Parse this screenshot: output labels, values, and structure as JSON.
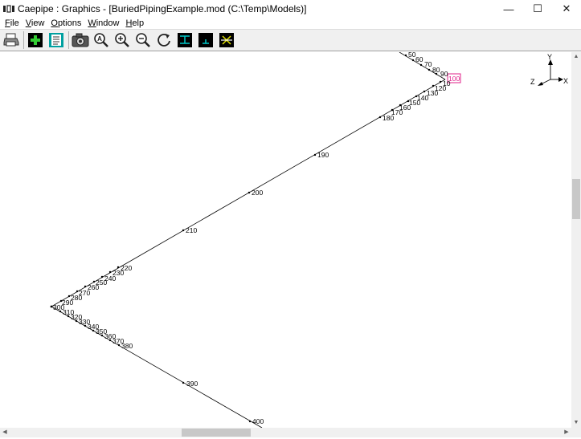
{
  "window": {
    "title": "Caepipe : Graphics -  [BuriedPipingExample.mod (C:\\Temp\\Models)]",
    "minimize": "—",
    "maximize": "☐",
    "close": "✕"
  },
  "menu": [
    {
      "label": "File",
      "underline": "F",
      "rest": "ile"
    },
    {
      "label": "View",
      "underline": "V",
      "rest": "iew"
    },
    {
      "label": "Options",
      "underline": "O",
      "rest": "ptions"
    },
    {
      "label": "Window",
      "underline": "W",
      "rest": "indow"
    },
    {
      "label": "Help",
      "underline": "H",
      "rest": "elp"
    }
  ],
  "toolbar": [
    {
      "name": "print-button",
      "icon": "printer-icon"
    },
    {
      "name": "add-node-button",
      "icon": "plus-box-icon"
    },
    {
      "name": "list-button",
      "icon": "list-icon"
    },
    {
      "name": "snapshot-button",
      "icon": "camera-icon"
    },
    {
      "name": "zoom-all-button",
      "icon": "zoom-all-icon"
    },
    {
      "name": "zoom-in-button",
      "icon": "zoom-in-icon"
    },
    {
      "name": "zoom-out-button",
      "icon": "zoom-out-icon"
    },
    {
      "name": "rotate-button",
      "icon": "rotate-icon"
    },
    {
      "name": "view-front-button",
      "icon": "view-front-icon"
    },
    {
      "name": "view-side-button",
      "icon": "view-side-icon"
    },
    {
      "name": "view-top-button",
      "icon": "view-top-icon"
    }
  ],
  "axes": {
    "y": "Y",
    "z": "Z",
    "x": "X"
  },
  "colors": {
    "highlight": "#e0208a",
    "line": "#000000",
    "toolbar_dark": "#000000",
    "toolbar_cyan": "#00c8c8"
  },
  "nodes": {
    "n50": "50",
    "n60": "60",
    "n70": "70",
    "n80": "80",
    "n90": "90",
    "n100": "100",
    "n10": "10",
    "n120": "120",
    "n130": "130",
    "n140": "140",
    "n150": "150",
    "n160": "160",
    "n170": "170",
    "n180": "180",
    "n190": "190",
    "n200": "200",
    "n210": "210",
    "n220": "220",
    "n230": "230",
    "n240": "240",
    "n250": "250",
    "n260": "260",
    "n270": "270",
    "n280": "280",
    "n290": "290",
    "n300": "300",
    "n310": "310",
    "n320": "320",
    "n330": "330",
    "n340": "340",
    "n350": "350",
    "n360": "360",
    "n370": "370",
    "n380": "380",
    "n390": "390",
    "n400": "400"
  }
}
